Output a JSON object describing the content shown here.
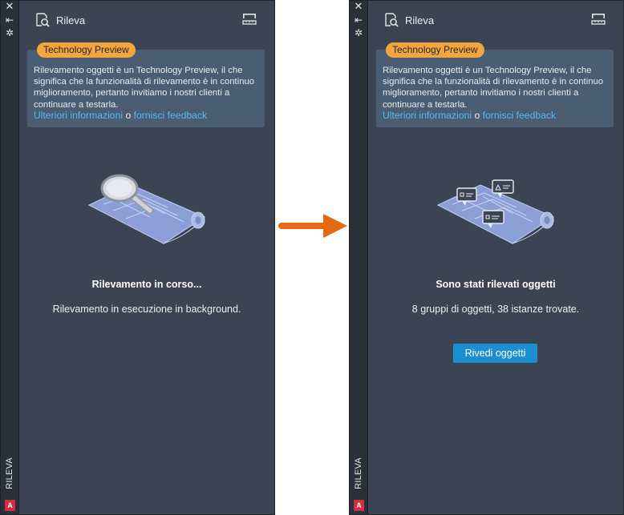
{
  "panels": [
    {
      "title": "Rileva",
      "badge": "Technology Preview",
      "info_text": "Rilevamento oggetti è un Technology Preview, il che significa che la funzionalità di rilevamento è in continuo miglioramento, pertanto invitiamo i nostri clienti a continuare a testarla.",
      "link_more": "Ulteriori informazioni",
      "link_sep": "o",
      "link_feedback": "fornisci feedback",
      "status_title": "Rilevamento in corso...",
      "status_desc": "Rilevamento in esecuzione in background.",
      "side_label": "RILEVA",
      "app_letter": "A"
    },
    {
      "title": "Rileva",
      "badge": "Technology Preview",
      "info_text": "Rilevamento oggetti è un Technology Preview, il che significa che la funzionalità di rilevamento è in continuo miglioramento, pertanto invitiamo i nostri clienti a continuare a testarla.",
      "link_more": "Ulteriori informazioni",
      "link_sep": "o",
      "link_feedback": "fornisci feedback",
      "status_title": "Sono stati rilevati oggetti",
      "status_desc": "8 gruppi di oggetti, 38 istanze trovate.",
      "button_label": "Rivedi oggetti",
      "side_label": "RILEVA",
      "app_letter": "A"
    }
  ],
  "controls": {
    "close": "✕",
    "pin": "⇤",
    "properties": "✲"
  },
  "colors": {
    "panel_bg": "#3b4453",
    "badge_bg": "#f4a63c",
    "link": "#58b7ef",
    "button_bg": "#1a8ed1",
    "arrow": "#e36a12",
    "app_icon": "#d52c3e"
  },
  "icons": {
    "header": "survey-magnifier-icon",
    "settings": "ruler-settings-icon",
    "illustration_scanning": "blueprint-magnifier-illustration",
    "illustration_detected": "blueprint-comments-illustration",
    "transition": "right-arrow-icon"
  }
}
